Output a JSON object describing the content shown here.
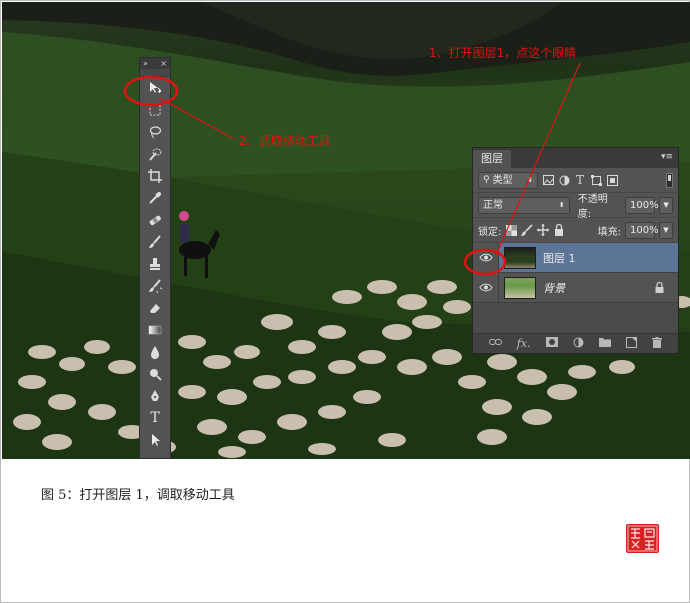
{
  "annotations": {
    "step1": "1、打开图层1，点这个眼睛",
    "step2": "2、调取移动工具"
  },
  "tools_panel": {
    "collapse_glyph": "»",
    "close_glyph": "×",
    "tools": [
      {
        "name": "move-tool",
        "icon": "move-icon"
      },
      {
        "name": "marquee-tool",
        "icon": "marquee-icon"
      },
      {
        "name": "lasso-tool",
        "icon": "lasso-icon"
      },
      {
        "name": "quick-selection-tool",
        "icon": "quick-selection-icon"
      },
      {
        "name": "crop-tool",
        "icon": "crop-icon"
      },
      {
        "name": "eyedropper-tool",
        "icon": "eyedropper-icon"
      },
      {
        "name": "healing-brush-tool",
        "icon": "bandage-icon"
      },
      {
        "name": "brush-tool",
        "icon": "brush-icon"
      },
      {
        "name": "clone-stamp-tool",
        "icon": "stamp-icon"
      },
      {
        "name": "history-brush-tool",
        "icon": "history-brush-icon"
      },
      {
        "name": "eraser-tool",
        "icon": "eraser-icon"
      },
      {
        "name": "gradient-tool",
        "icon": "gradient-icon"
      },
      {
        "name": "blur-tool",
        "icon": "drop-icon"
      },
      {
        "name": "dodge-tool",
        "icon": "dodge-icon"
      },
      {
        "name": "pen-tool",
        "icon": "pen-icon"
      },
      {
        "name": "type-tool",
        "icon": "type-icon"
      },
      {
        "name": "path-selection-tool",
        "icon": "path-selection-icon"
      }
    ],
    "type_glyph": "T"
  },
  "layers_panel": {
    "tab_label": "图层",
    "menu_glyph": "▾≡",
    "filter_kind": "类型",
    "filter_icons": [
      "image-filter-icon",
      "adjustment-filter-icon",
      "type-filter-icon",
      "shape-filter-icon",
      "smart-object-filter-icon"
    ],
    "type_filter_glyph": "T",
    "blend_mode": "正常",
    "opacity_label": "不透明度:",
    "opacity_value": "100%",
    "lock_label": "锁定:",
    "fill_label": "填充:",
    "fill_value": "100%",
    "layers": [
      {
        "name": "图层 1",
        "visible": true,
        "selected": true
      },
      {
        "name": "背景",
        "visible": true,
        "selected": false,
        "locked": true
      }
    ],
    "bottom_icons": [
      "link-icon",
      "fx-icon",
      "mask-icon",
      "adjustment-icon",
      "folder-icon",
      "new-layer-icon",
      "trash-icon"
    ],
    "fx_label": "fx."
  },
  "caption": "图 5：打开图层 1，调取移动工具",
  "colors": {
    "annotation_red": "#e01212",
    "panel_bg": "#535353",
    "selected_layer": "#5c7596"
  }
}
